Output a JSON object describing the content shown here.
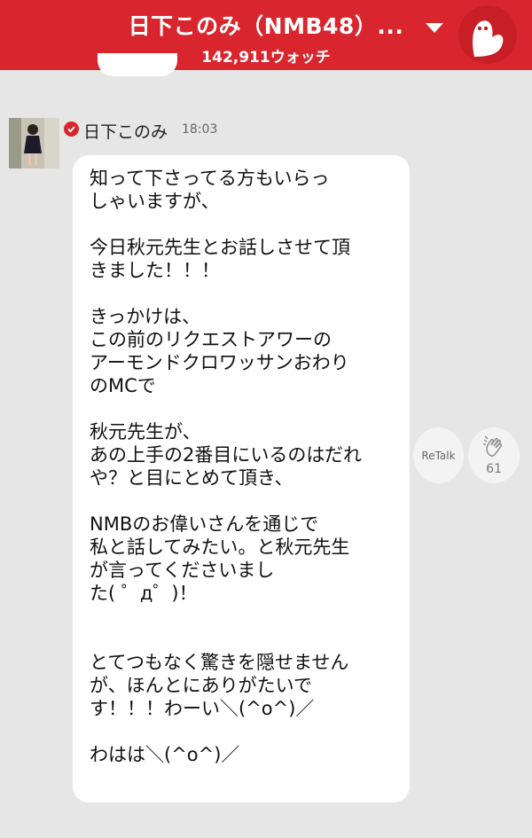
{
  "header": {
    "title": "日下このみ（NMB48）...",
    "watch_count": "142,911ウォッチ"
  },
  "icons": {
    "dropdown": "chevron-down-icon",
    "mascot": "mascot-icon",
    "verified": "verified-check-icon",
    "clap": "clap-icon"
  },
  "message": {
    "sender": "日下このみ",
    "time": "18:03",
    "text": "知って下さってる方もいらっ\nしゃいますが、\n\n今日秋元先生とお話しさせて頂\nきました！！！\n\nきっかけは、\nこの前のリクエストアワーの\nアーモンドクロワッサンおわり\nのMCで\n\n秋元先生が、\nあの上手の2番目にいるのはだれ\nや？と目にとめて頂き、\n\nNMBのお偉いさんを通じで\n私と話してみたい。と秋元先生\nが言ってくださいまし\nた( ゜д゜)！\n\n\nとてつもなく驚きを隠せません\nが、ほんとにありがたいで\nす！！！わーい＼(^o^)／\n\nわはは＼(^o^)／"
  },
  "actions": {
    "retalk_label": "ReTalk",
    "clap_count": "61"
  },
  "colors": {
    "header_bg": "#d9262e",
    "background": "#e6e6e6",
    "bubble": "#ffffff"
  }
}
